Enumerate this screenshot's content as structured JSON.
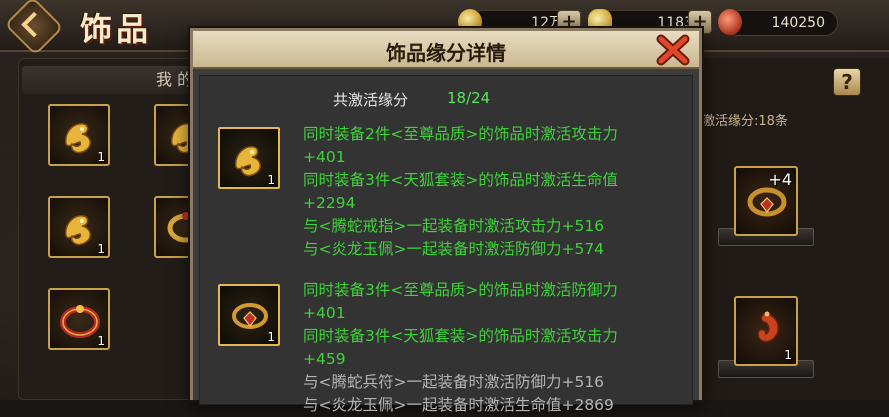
{
  "header": {
    "title": "饰品",
    "resources": [
      {
        "icon": "gold-coin-icon",
        "value": "12万"
      },
      {
        "icon": "gold-ingot-icon",
        "value": "1183"
      },
      {
        "icon": "jade-token-icon",
        "value": "140250"
      }
    ],
    "plus_label": "+"
  },
  "left_panel": {
    "header_label": "我 的",
    "slots": [
      {
        "item": "gold-phoenix-pendant",
        "qty": "1"
      },
      {
        "item": "gold-phoenix-pendant",
        "qty": "1"
      },
      {
        "item": "gold-phoenix-pendant",
        "qty": "1"
      },
      {
        "item": "gold-ring",
        "qty": "1"
      },
      {
        "item": "red-dragon-ring",
        "qty": "1"
      }
    ]
  },
  "right_panel": {
    "help_label": "?",
    "caption": "激活缘分:18条",
    "slots": [
      {
        "item": "fox-ring",
        "level": "+4",
        "qty": ""
      },
      {
        "item": "jade-pendant",
        "level": "",
        "qty": "1"
      }
    ]
  },
  "modal": {
    "title": "饰品缘分详情",
    "summary_label": "共激活缘分",
    "summary_value": "18/24",
    "entries": [
      {
        "item": "gold-phoenix-pendant",
        "qty": "1",
        "lines": [
          {
            "text": "同时装备2件<至尊品质>的饰品时激活攻击力",
            "active": true
          },
          {
            "text": "+401",
            "active": true
          },
          {
            "text": "同时装备3件<天狐套装>的饰品时激活生命值",
            "active": true
          },
          {
            "text": "+2294",
            "active": true
          },
          {
            "text": "与<腾蛇戒指>一起装备时激活攻击力+516",
            "active": true
          },
          {
            "text": "与<炎龙玉佩>一起装备时激活防御力+574",
            "active": true
          }
        ]
      },
      {
        "item": "fox-ring",
        "qty": "1",
        "lines": [
          {
            "text": "同时装备3件<至尊品质>的饰品时激活防御力",
            "active": true
          },
          {
            "text": "+401",
            "active": true
          },
          {
            "text": "同时装备3件<天狐套装>的饰品时激活攻击力",
            "active": true
          },
          {
            "text": "+459",
            "active": true
          },
          {
            "text": "与<腾蛇兵符>一起装备时激活防御力+516",
            "active": false
          },
          {
            "text": "与<炎龙玉佩>一起装备时激活生命值+2869",
            "active": false
          }
        ]
      }
    ]
  },
  "colors": {
    "active_text": "#3fd23a",
    "inactive_text": "#b4b4b4",
    "summary_value": "#58e35a",
    "slot_border": "#e4b850"
  }
}
